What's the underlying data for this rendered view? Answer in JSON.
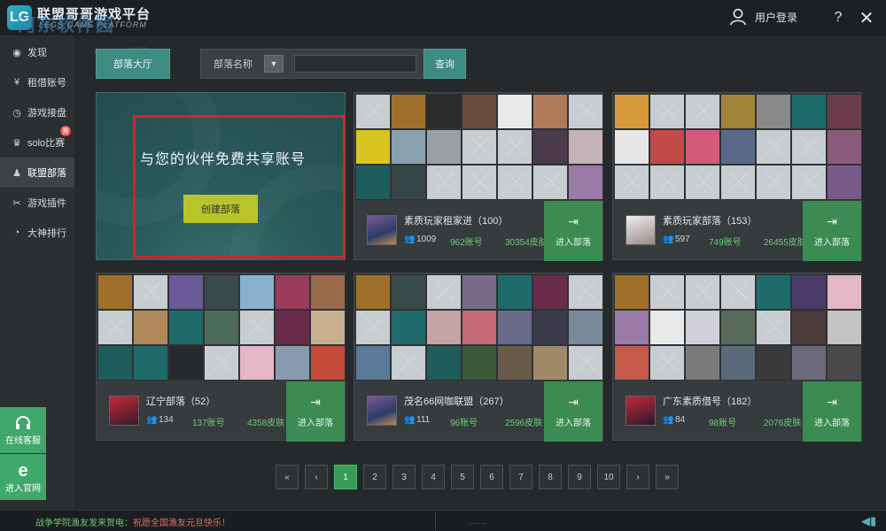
{
  "app": {
    "title": "联盟哥哥游戏平台",
    "subtitle": "LEGS GAME PLATFORM",
    "logo_text": "LG",
    "user_login": "用户登录",
    "help": "?",
    "close": "✕"
  },
  "watermark": {
    "text": "河东软件园",
    "sub": "www.pc0359.cn"
  },
  "sidebar": {
    "items": [
      {
        "label": "发现",
        "icon": "eye-icon"
      },
      {
        "label": "租借账号",
        "icon": "yen-icon"
      },
      {
        "label": "游戏接盘",
        "icon": "clock-icon"
      },
      {
        "label": "solo比赛",
        "icon": "trophy-icon",
        "badge": "赛"
      },
      {
        "label": "联盟部落",
        "icon": "tribe-icon",
        "active": true
      },
      {
        "label": "游戏插件",
        "icon": "tools-icon"
      },
      {
        "label": "大神排行",
        "icon": "rank-icon"
      }
    ],
    "service_label": "在线客服",
    "website_label": "进入官网"
  },
  "filter": {
    "lobby_label": "部落大厅",
    "name_label": "部落名称",
    "input_value": "",
    "query_label": "查询"
  },
  "create": {
    "text": "与您的伙伴免费共享账号",
    "button": "创建部落"
  },
  "tribes": [
    {
      "name": "素质玩家租家进（100）",
      "members": "1009",
      "accounts": "962账号",
      "skins": "30354皮肤",
      "join": "进入部落"
    },
    {
      "name": "素质玩家部落（153）",
      "members": "597",
      "accounts": "749账号",
      "skins": "26455皮肤",
      "join": "进入部落"
    },
    {
      "name": "辽宁部落（52）",
      "members": "134",
      "accounts": "137账号",
      "skins": "4358皮肤",
      "join": "进入部落"
    },
    {
      "name": "茂名66网咖联盟（267）",
      "members": "111",
      "accounts": "96账号",
      "skins": "2596皮肤",
      "join": "进入部落"
    },
    {
      "name": "广东素质借号（182）",
      "members": "84",
      "accounts": "98账号",
      "skins": "2076皮肤",
      "join": "进入部落"
    }
  ],
  "pagination": {
    "first": "«",
    "prev": "‹",
    "pages": [
      "1",
      "2",
      "3",
      "4",
      "5",
      "6",
      "7",
      "8",
      "9",
      "10"
    ],
    "current": "1",
    "next": "›",
    "last": "»"
  },
  "statusbar": {
    "message_a": "战争学院渔友发来贺电：",
    "message_b": "祝愿全国渔友元旦快乐！",
    "dots": "......"
  },
  "colors": {
    "accent_green": "#3b8b52",
    "teal": "#3e8b82",
    "create_yellow": "#b9c42a",
    "stat_green": "#6dcb73",
    "highlight_red": "#d3242a"
  }
}
